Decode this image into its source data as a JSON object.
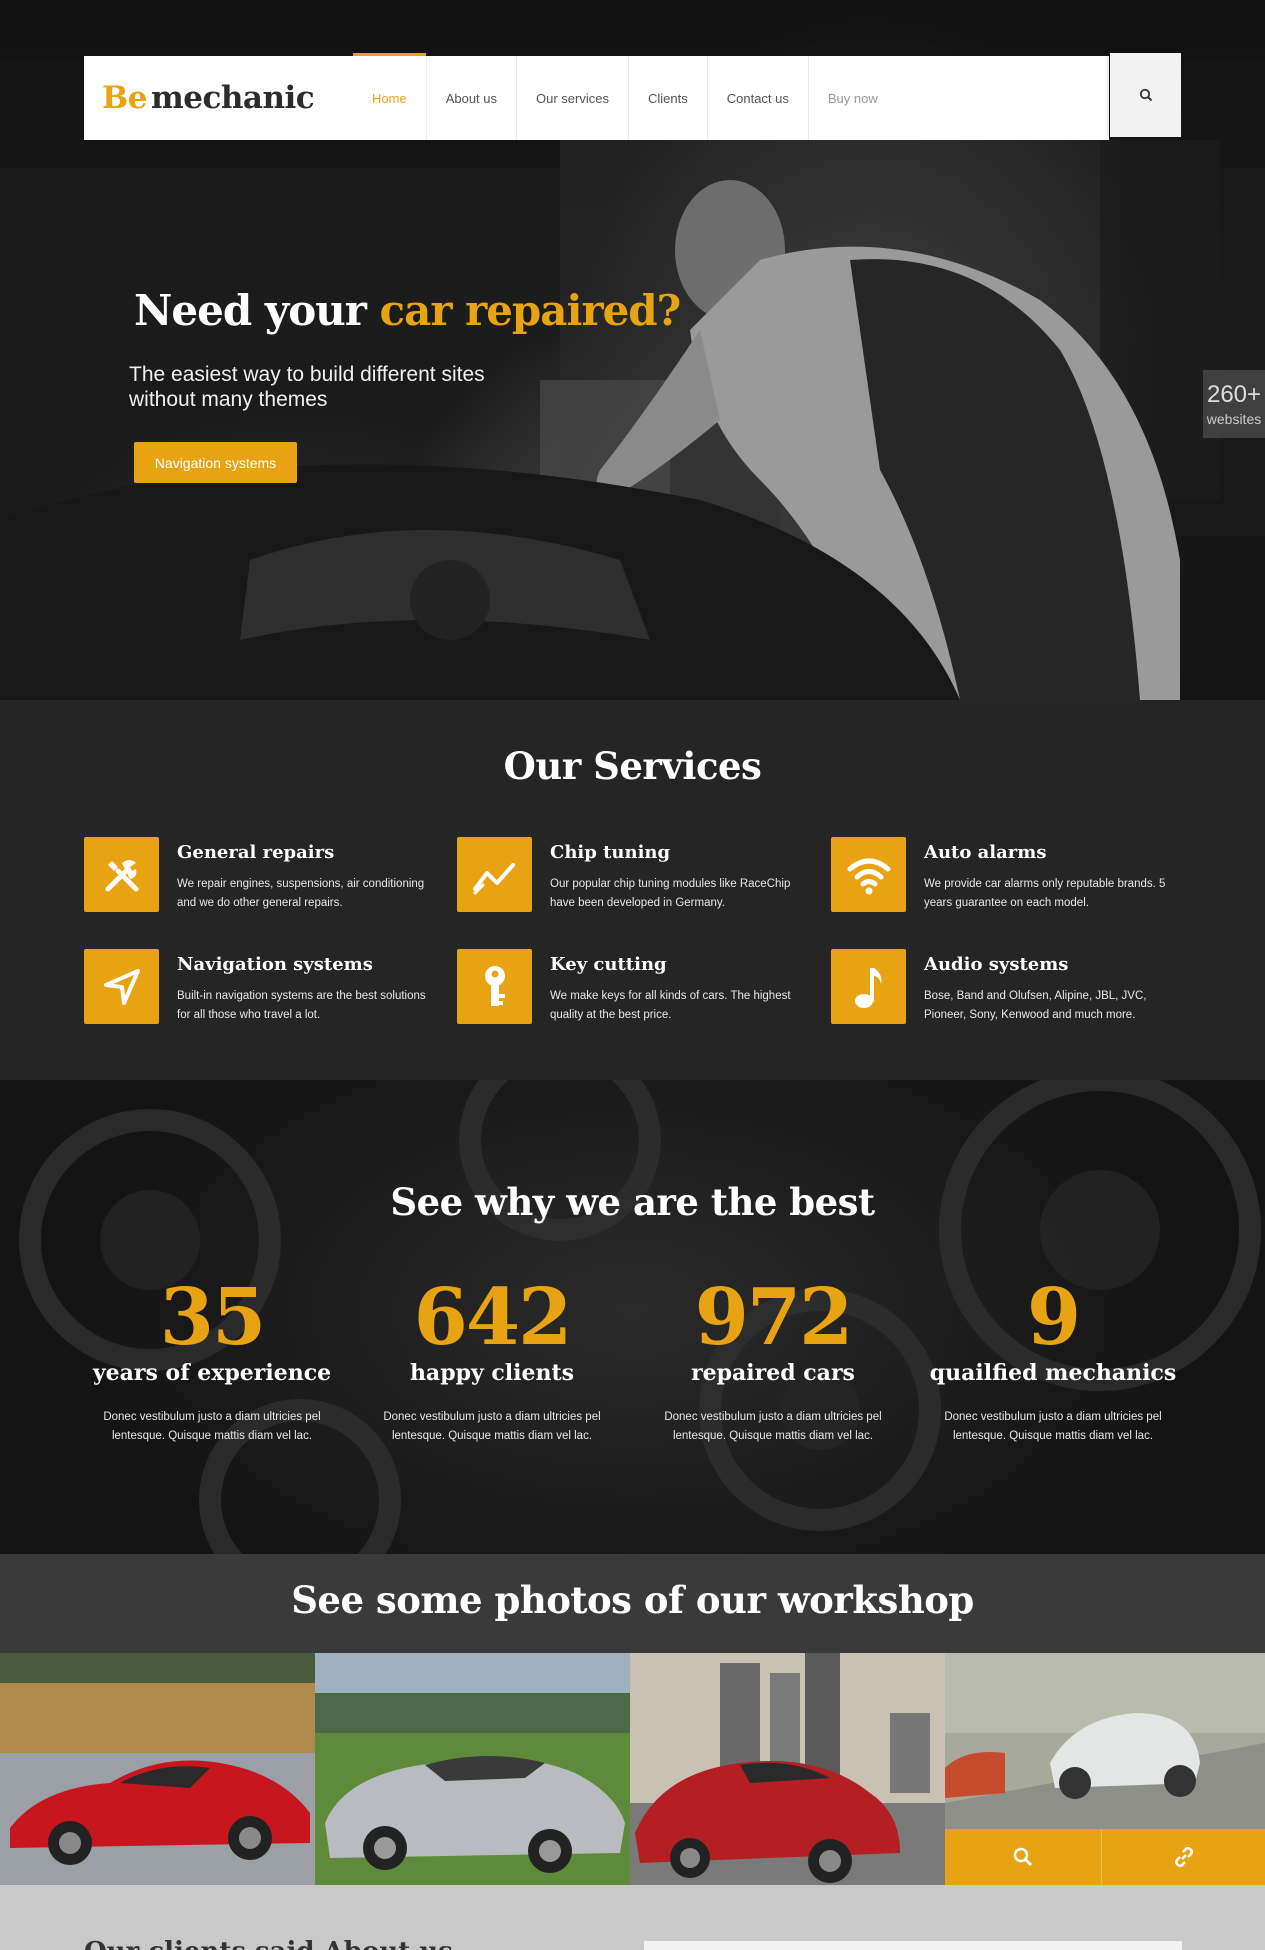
{
  "nav": {
    "logo_be": "Be",
    "logo_mechanic": "mechanic",
    "items": [
      {
        "label": "Home",
        "active": true
      },
      {
        "label": "About us"
      },
      {
        "label": "Our services"
      },
      {
        "label": "Clients"
      },
      {
        "label": "Contact us"
      },
      {
        "label": "Buy now"
      }
    ]
  },
  "hero": {
    "title_plain": "Need your ",
    "title_accent": "car repaired?",
    "subtitle": "The easiest way to build different sites without many themes",
    "button": "Navigation systems",
    "badge_number": "260+",
    "badge_label": "websites"
  },
  "services": {
    "title": "Our Services",
    "items": [
      {
        "title": "General repairs",
        "desc": "We repair engines, suspensions, air conditioning and we do other general repairs.",
        "icon": "tools-icon"
      },
      {
        "title": "Chip tuning",
        "desc": "Our popular chip tuning modules like RaceChip have been developed in Germany.",
        "icon": "chart-line-icon"
      },
      {
        "title": "Auto alarms",
        "desc": "We provide car alarms only reputable brands. 5 years guarantee on each model.",
        "icon": "wifi-icon"
      },
      {
        "title": "Navigation systems",
        "desc": "Built-in navigation systems are the best solutions for all those who travel a lot.",
        "icon": "navigation-arrow-icon"
      },
      {
        "title": "Key cutting",
        "desc": "We make keys for all kinds of cars. The highest quality at the best price.",
        "icon": "key-icon"
      },
      {
        "title": "Audio systems",
        "desc": "Bose, Band and Olufsen, Alipine, JBL, JVC, Pioneer, Sony, Kenwood and much more.",
        "icon": "music-note-icon"
      }
    ]
  },
  "stats": {
    "title": "See why we are the best",
    "items": [
      {
        "number": "35",
        "label": "years of experience",
        "desc": "Donec vestibulum justo a diam ultricies pel lentesque. Quisque mattis diam vel lac."
      },
      {
        "number": "642",
        "label": "happy clients",
        "desc": "Donec vestibulum justo a diam ultricies pel lentesque. Quisque mattis diam vel lac."
      },
      {
        "number": "972",
        "label": "repaired cars",
        "desc": "Donec vestibulum justo a diam ultricies pel lentesque. Quisque mattis diam vel lac."
      },
      {
        "number": "9",
        "label": "quailfied mechanics",
        "desc": "Donec vestibulum justo a diam ultricies pel lentesque. Quisque mattis diam vel lac."
      }
    ]
  },
  "photos": {
    "title": "See some photos of our workshop"
  },
  "bottom": {
    "title": "Our clients said        About us"
  },
  "colors": {
    "accent": "#e8a312",
    "dark": "#252525"
  }
}
